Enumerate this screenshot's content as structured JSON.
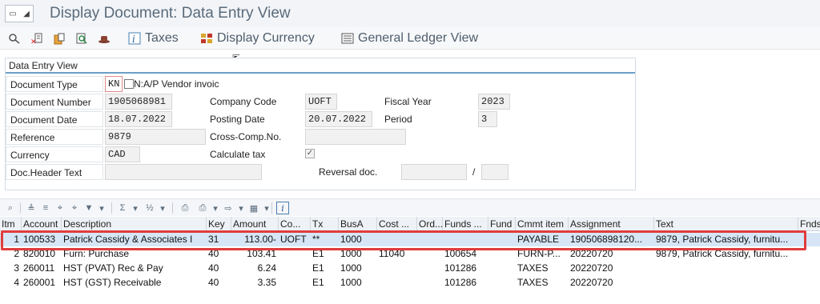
{
  "window": {
    "title": "Display Document: Data Entry View"
  },
  "toolbar": {
    "taxes": "Taxes",
    "display_currency": "Display Currency",
    "general_ledger_view": "General Ledger View"
  },
  "header": {
    "section_title": "Data Entry View",
    "document_type_label": "Document Type",
    "document_type_value": "KN",
    "document_type_desc": "N:A/P Vendor invoic",
    "document_number_label": "Document Number",
    "document_number_value": "1905068981",
    "company_code_label": "Company Code",
    "company_code_value": "UOFT",
    "fiscal_year_label": "Fiscal Year",
    "fiscal_year_value": "2023",
    "document_date_label": "Document Date",
    "document_date_value": "18.07.2022",
    "posting_date_label": "Posting Date",
    "posting_date_value": "20.07.2022",
    "period_label": "Period",
    "period_value": "3",
    "reference_label": "Reference",
    "reference_value": "9879",
    "cross_comp_label": "Cross-Comp.No.",
    "cross_comp_value": "",
    "currency_label": "Currency",
    "currency_value": "CAD",
    "calculate_tax_label": "Calculate tax",
    "calculate_tax_checked": "✓",
    "doc_header_text_label": "Doc.Header Text",
    "doc_header_text_value": "",
    "reversal_doc_label": "Reversal doc.",
    "reversal_doc_value": "",
    "reversal_sep": "/",
    "reversal_doc_year": ""
  },
  "table": {
    "columns": [
      "Itm",
      "Account",
      "Description",
      "Key",
      "Amount",
      "Co...",
      "Tx",
      "BusA",
      "Cost ...",
      "Ord...",
      "Funds ...",
      "Fund",
      "Cmmt item",
      "Assignment",
      "Text",
      "Fnds"
    ],
    "rows": [
      [
        "1",
        "100533",
        "Patrick Cassidy & Associates I",
        "31",
        "113.00-",
        "UOFT",
        "**",
        "1000",
        "",
        "",
        "",
        "",
        "PAYABLE",
        "190506898120...",
        "9879, Patrick Cassidy, furnitu...",
        ""
      ],
      [
        "2",
        "820010",
        "Furn:  Purchase",
        "40",
        "103.41",
        "",
        "E1",
        "1000",
        "11040",
        "",
        "100654",
        "",
        "FURN-P...",
        "20220720",
        "9879, Patrick Cassidy, furnitu...",
        ""
      ],
      [
        "3",
        "260011",
        "HST (PVAT) Rec & Pay",
        "40",
        "6.24",
        "",
        "E1",
        "1000",
        "",
        "",
        "101286",
        "",
        "TAXES",
        "20220720",
        "",
        ""
      ],
      [
        "4",
        "260001",
        "HST (GST) Receivable",
        "40",
        "3.35",
        "",
        "E1",
        "1000",
        "",
        "",
        "101286",
        "",
        "TAXES",
        "20220720",
        "",
        ""
      ]
    ]
  },
  "colors": {
    "highlight": "#e03c3c",
    "selected_row": "#d6e6f6",
    "title_text": "#5a6b7b"
  }
}
